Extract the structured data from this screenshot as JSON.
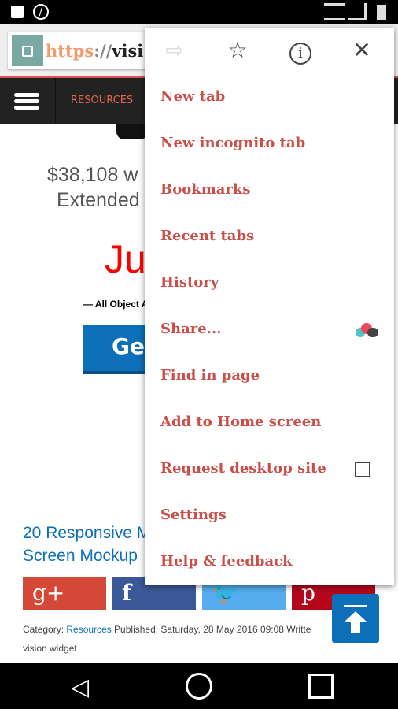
{
  "browser": {
    "url_scheme": "https",
    "url_sep": "://",
    "url_host": "visi"
  },
  "site": {
    "nav_item": "RESOURCES",
    "price_line": "$38,108 w",
    "extended_line": "Extended",
    "red_text": "Ju",
    "object_line": "— All Object A",
    "cta_label": "Get",
    "article_title_1": "20 Responsive M",
    "article_title_2": "Screen Mockup",
    "social": [
      {
        "name": "google-plus",
        "label": "g+",
        "color": "#d34836"
      },
      {
        "name": "facebook",
        "label": "f",
        "color": "#3b5998"
      },
      {
        "name": "twitter",
        "label": "🐦",
        "color": "#55acee"
      },
      {
        "name": "pinterest",
        "label": "p",
        "color": "#b5071c"
      }
    ],
    "meta": {
      "category_label": "Category: ",
      "category": "Resources",
      "published": " Published: Saturday, 28 May 2016 09:08 Writte",
      "author": "vision widget"
    }
  },
  "menu": {
    "icons": [
      "forward-icon",
      "bookmark-star-icon",
      "info-icon",
      "close-icon"
    ],
    "items": [
      "New tab",
      "New incognito tab",
      "Bookmarks",
      "Recent tabs",
      "History",
      "Share...",
      "Find in page",
      "Add to Home screen",
      "Request desktop site",
      "Settings",
      "Help & feedback"
    ],
    "request_desktop_checked": false,
    "accent": "#c9504a"
  }
}
